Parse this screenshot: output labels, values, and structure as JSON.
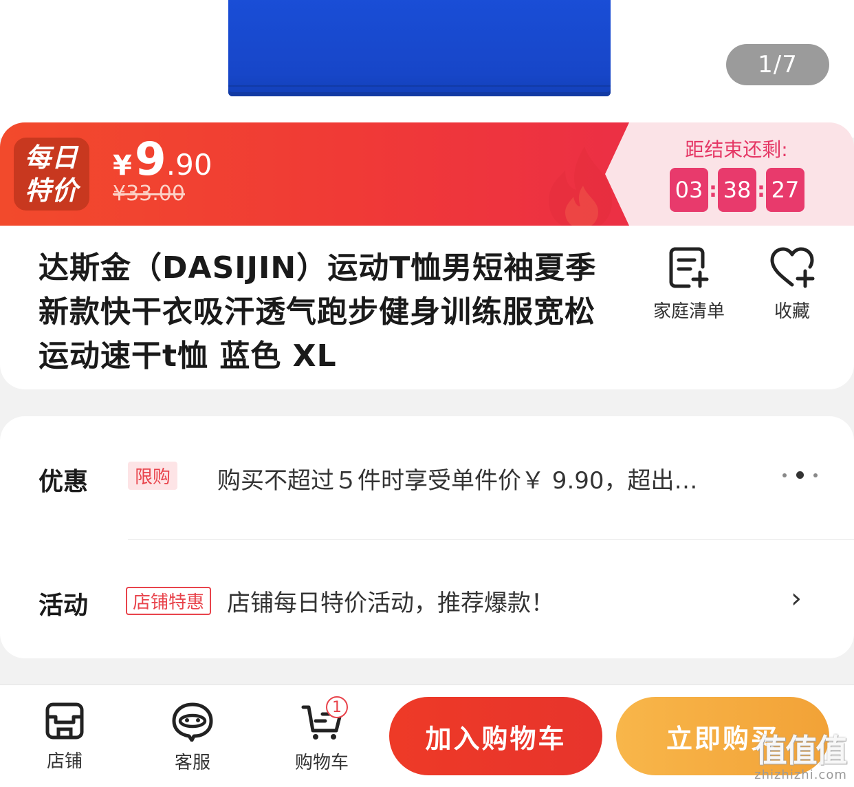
{
  "gallery": {
    "pager": "1/7"
  },
  "banner": {
    "badge_line1": "每日",
    "badge_line2": "特价",
    "currency": "¥",
    "price_int": "9",
    "price_dec": ".90",
    "old_price": "¥33.00",
    "countdown_label": "距结束还剩:",
    "countdown": {
      "hours": "03",
      "minutes": "38",
      "seconds": "27",
      "sep": ":"
    }
  },
  "product": {
    "title": "达斯金（DASIJIN）运动T恤男短袖夏季新款快干衣吸汗透气跑步健身训练服宽松运动速干t恤 蓝色 XL",
    "actions": {
      "family_list": "家庭清单",
      "favorite": "收藏"
    }
  },
  "promo": {
    "discount_label": "优惠",
    "discount_tag": "限购",
    "discount_text": "购买不超过５件时享受单件价￥ 9.90，超出…",
    "activity_label": "活动",
    "activity_tag": "店铺特惠",
    "activity_text": "店铺每日特价活动，推荐爆款！",
    "chevron": "›"
  },
  "bottom_bar": {
    "shop": "店铺",
    "service": "客服",
    "cart": "购物车",
    "cart_count": "1",
    "add_to_cart": "加入购物车",
    "buy_now": "立即购买"
  },
  "watermark": {
    "big": "值值值",
    "small": "zhizhizhi.com"
  },
  "colors": {
    "accent_red": "#f03a36",
    "countdown_pink": "#e83a6c",
    "buy_orange": "#f2a237",
    "product_blue": "#1746c8"
  }
}
